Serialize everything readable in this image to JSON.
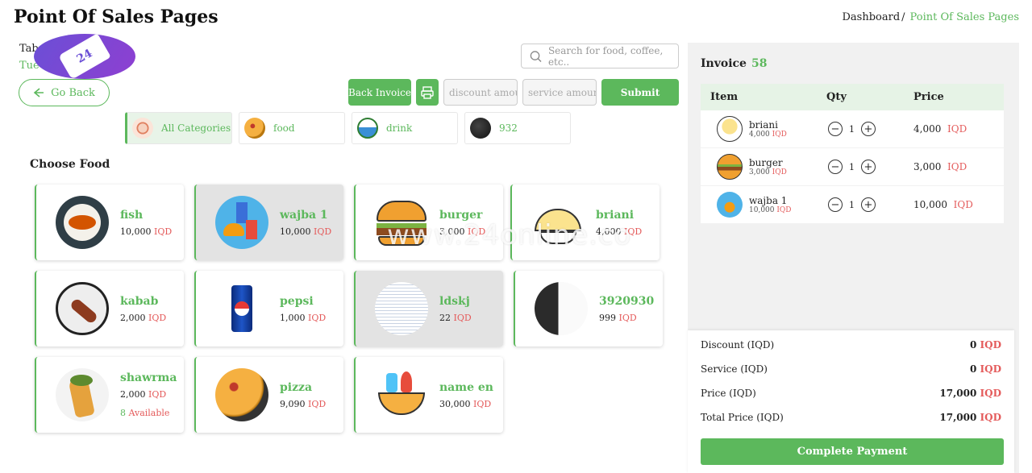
{
  "header": {
    "title": "Point Of Sales Pages",
    "breadcrumb_home": "Dashboard",
    "breadcrumb_sep": "/",
    "breadcrumb_current": "Point Of Sales Pages"
  },
  "table_label": "Tab",
  "date_label": "Tue",
  "go_back": "Go Back",
  "search": {
    "placeholder": "Search for food, coffee, etc.."
  },
  "toolbar": {
    "back_invoice": "Back Invoice",
    "discount_placeholder": "discount amount",
    "service_placeholder": "service amount",
    "submit": "Submit"
  },
  "categories": [
    {
      "label": "All Categories"
    },
    {
      "label": "food"
    },
    {
      "label": "drink"
    },
    {
      "label": "932"
    }
  ],
  "choose_food": "Choose Food",
  "currency": "IQD",
  "foods": [
    {
      "name": "fish",
      "price": "10,000"
    },
    {
      "name": "wajba 1",
      "price": "10,000"
    },
    {
      "name": "burger",
      "price": "3,000"
    },
    {
      "name": "briani",
      "price": "4,000"
    },
    {
      "name": "kabab",
      "price": "2,000"
    },
    {
      "name": "pepsi",
      "price": "1,000"
    },
    {
      "name": "ldskj",
      "price": "22"
    },
    {
      "name": "3920930",
      "price": "999"
    },
    {
      "name": "shawrma",
      "price": "2,000",
      "available_count": "8",
      "available_label": "Available"
    },
    {
      "name": "pizza",
      "price": "9,090"
    },
    {
      "name": "name en",
      "price": "30,000"
    }
  ],
  "watermark": "www.24online.co",
  "invoice": {
    "title": "Invoice",
    "number": "58",
    "col_item": "Item",
    "col_qty": "Qty",
    "col_price": "Price",
    "rows": [
      {
        "name": "briani",
        "unit": "4,000",
        "qty": "1",
        "total": "4,000"
      },
      {
        "name": "burger",
        "unit": "3,000",
        "qty": "1",
        "total": "3,000"
      },
      {
        "name": "wajba 1",
        "unit": "10,000",
        "qty": "1",
        "total": "10,000"
      }
    ],
    "discount_label": "Discount (IQD)",
    "discount_value": "0",
    "service_label": "Service (IQD)",
    "service_value": "0",
    "price_label": "Price (IQD)",
    "price_value": "17,000",
    "total_label": "Total Price (IQD)",
    "total_value": "17,000",
    "complete": "Complete Payment"
  }
}
